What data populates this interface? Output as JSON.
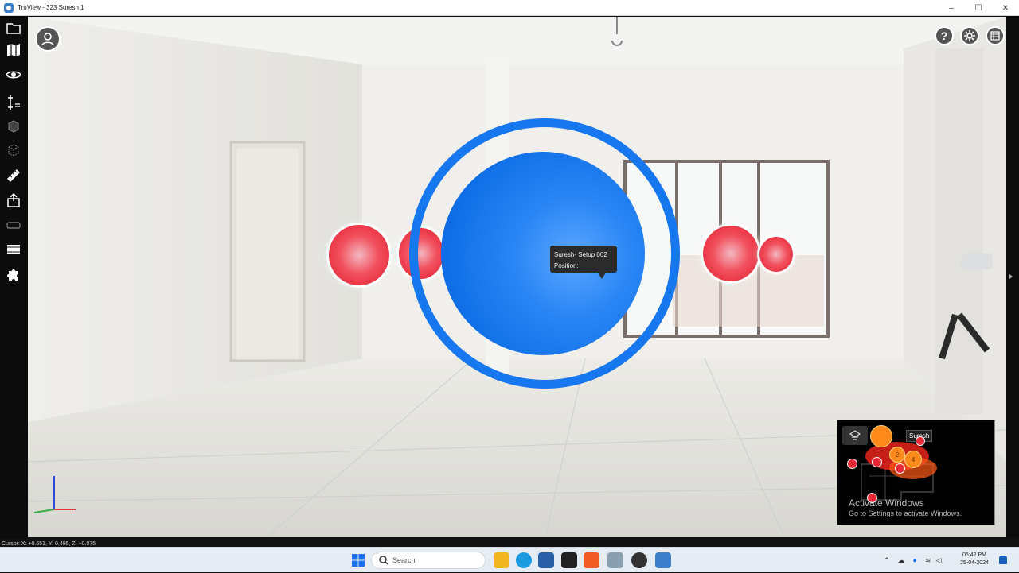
{
  "window": {
    "title": "TruView - 323 Suresh 1",
    "controls": [
      "–",
      "☐",
      "✕"
    ]
  },
  "toolbar": {
    "tools": [
      "folder-icon",
      "map-icon",
      "eye-icon",
      "measure-icon",
      "cube-icon",
      "box-outline-icon",
      "ruler-icon",
      "export-icon",
      "vr-headset-icon",
      "film-icon",
      "puzzle-icon"
    ]
  },
  "viewport": {
    "tooltip": {
      "line1": "Suresh- Setup 002",
      "line2": "Position:"
    },
    "top_right_icons": [
      "help-icon",
      "settings-icon",
      "layers-icon"
    ],
    "help_glyph": "?"
  },
  "minimap": {
    "label": "Suresh",
    "numbers": [
      "2",
      "4"
    ],
    "watermark": {
      "title": "Activate Windows",
      "subtitle": "Go to Settings to activate Windows."
    }
  },
  "status": {
    "cursor": "Cursor: X: +0.651, Y: 0.495, Z: +0.075"
  },
  "taskbar": {
    "search_placeholder": "Search",
    "time": "05:42 PM",
    "date": "25-04-2024"
  }
}
